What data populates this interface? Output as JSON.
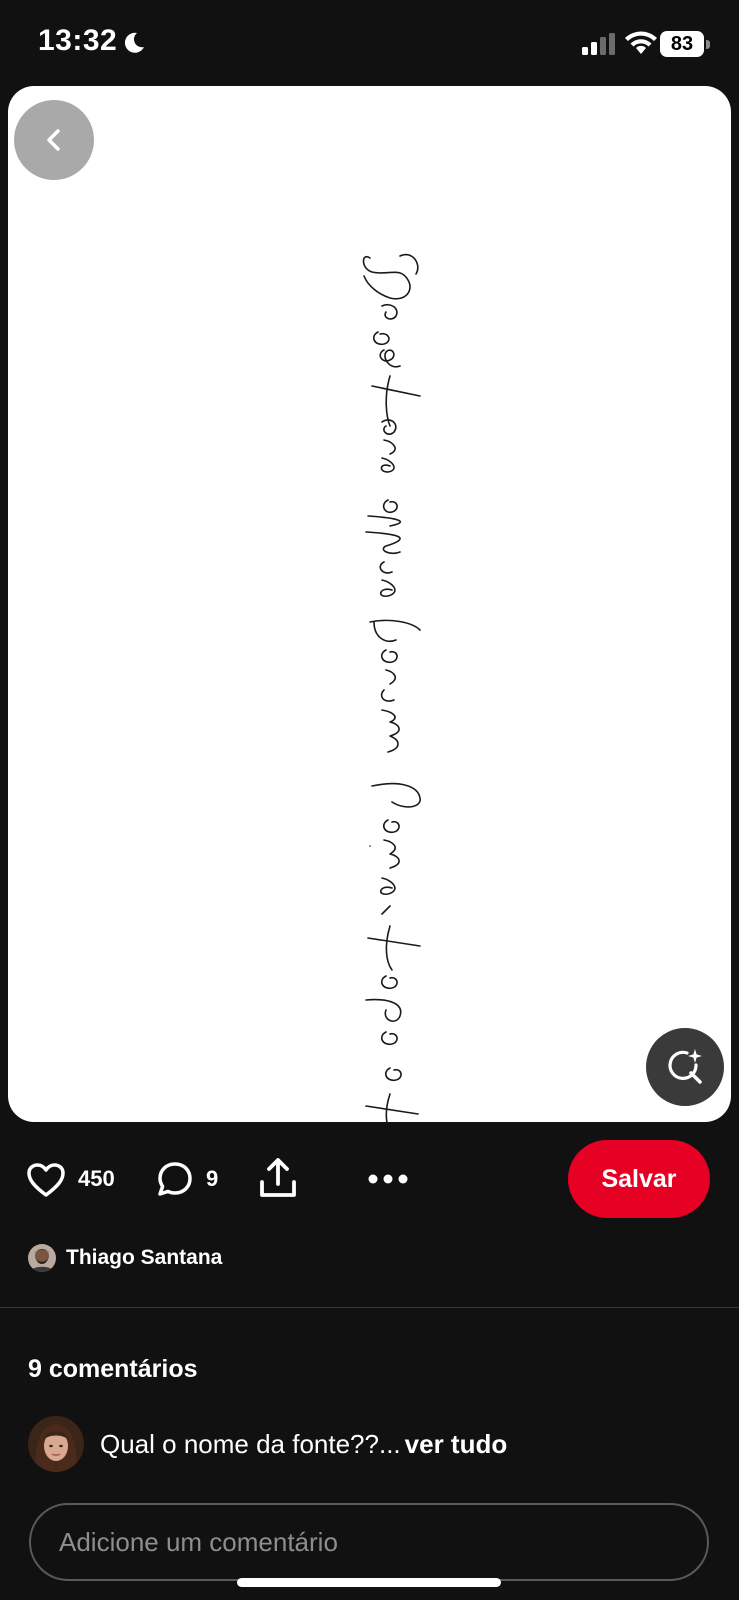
{
  "status_bar": {
    "time": "13:32",
    "battery_level": "83",
    "icons": [
      "moon-icon",
      "signal-icon",
      "wifi-icon",
      "battery-icon"
    ]
  },
  "pin": {
    "image_text": "Se os teus olhos forem bons, todo o teu corpo terá luz.",
    "icons": [
      "back-icon",
      "visual-search-icon"
    ]
  },
  "actions": {
    "like_count": "450",
    "comment_count": "9",
    "save_label": "Salvar",
    "icons": [
      "heart-icon",
      "comment-icon",
      "share-icon",
      "more-icon"
    ]
  },
  "author": {
    "name": "Thiago Santana"
  },
  "comments": {
    "heading": "9 comentários",
    "items": [
      {
        "text": "Qual o nome da fonte??...",
        "more_label": "ver tudo"
      }
    ],
    "input_placeholder": "Adicione um comentário"
  },
  "colors": {
    "background": "#111111",
    "save_button": "#e60023",
    "card": "#ffffff"
  }
}
